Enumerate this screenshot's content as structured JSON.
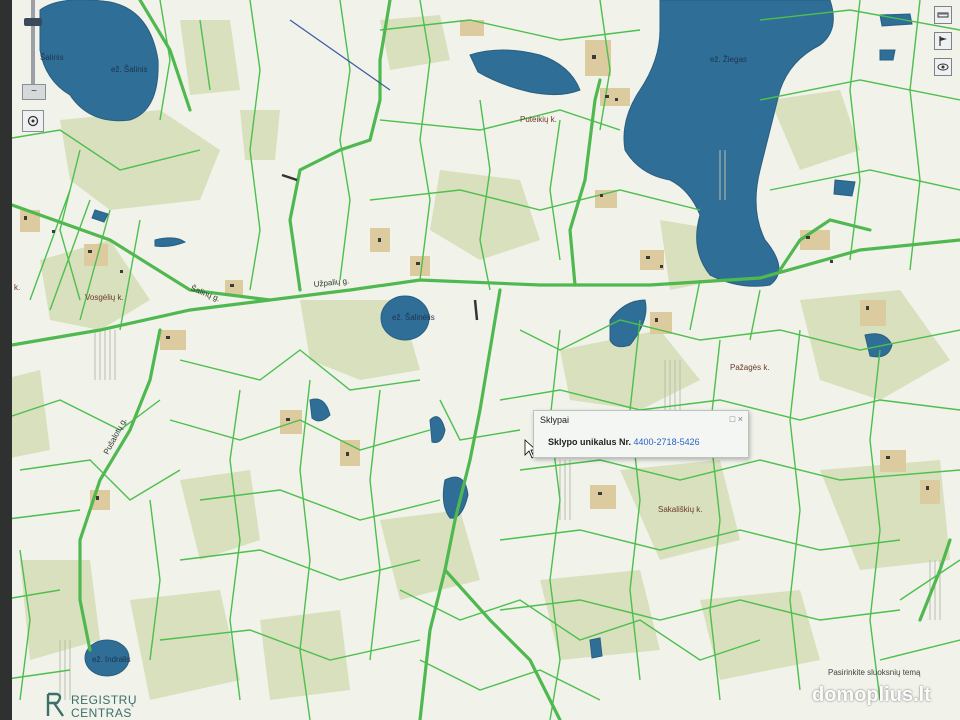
{
  "map": {
    "colors": {
      "background": "#f3f3ec",
      "forest": "#d8e0bd",
      "sand": "#d9c79e",
      "water": "#2f6f97",
      "parcel_line": "#4cbf4c",
      "road": "#4db84d"
    },
    "lakes": [
      {
        "name": "ež. Šalinis"
      },
      {
        "name": "ež. Žiegas"
      },
      {
        "name": "ež. Šalinėlis"
      },
      {
        "name": "ež. Indralis"
      }
    ],
    "villages": [
      {
        "name": "Puteikių k."
      },
      {
        "name": "Vosgėlių k."
      },
      {
        "name": "Pažagės k."
      },
      {
        "name": "Sakališkių k."
      }
    ],
    "roads": [
      {
        "name": "Šalinų g."
      },
      {
        "name": "Užpalių g."
      },
      {
        "name": "Pušalotų g."
      }
    ],
    "extra_label": "k.",
    "small_label": "Šalinis"
  },
  "controls": {
    "zoom_minus": "−",
    "locate_icon": "crosshair-icon",
    "right_tools": [
      "ruler-icon",
      "flag-icon",
      "eye-icon"
    ]
  },
  "popup": {
    "title": "Sklypai",
    "ctrl_max": "□",
    "ctrl_close": "×",
    "field_label": "Sklypo unikalus Nr.",
    "field_value": "4400-2718-5426"
  },
  "layer_hint": "Pasirinkite sluoksnių temą",
  "logo": {
    "line1": "REGISTRŲ",
    "line2": "CENTRAS"
  },
  "watermark": "domoplius.lt"
}
